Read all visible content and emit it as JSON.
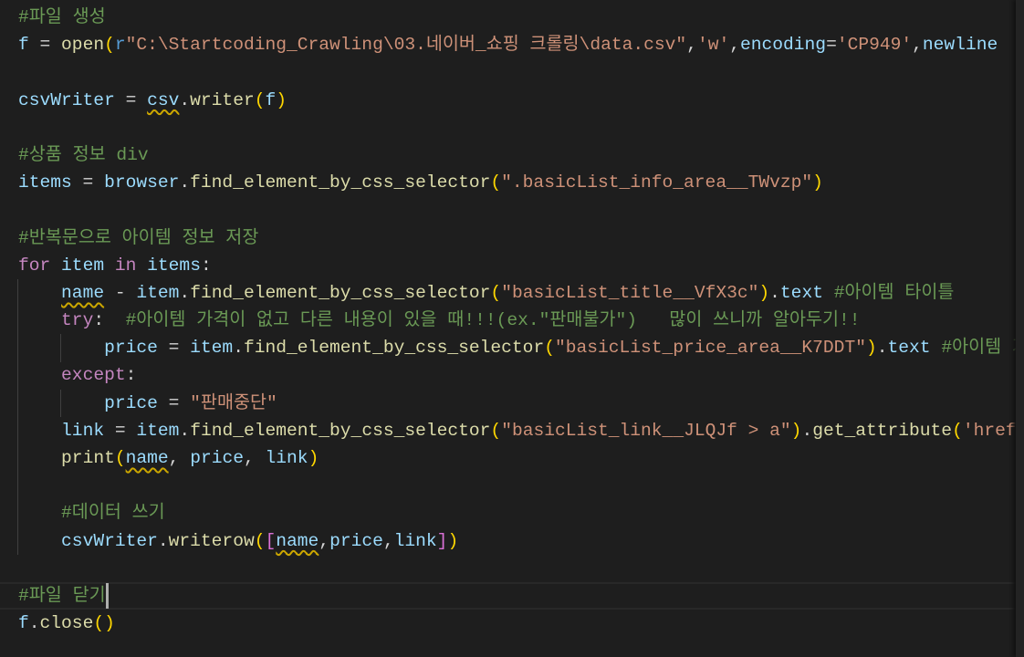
{
  "editor": {
    "current_line": 22,
    "lines": [
      [
        [
          "cm",
          "#파일 생성"
        ]
      ],
      [
        [
          "var",
          "f"
        ],
        [
          "def",
          " = "
        ],
        [
          "fn",
          "open"
        ],
        [
          "b1",
          "("
        ],
        [
          "pre",
          "r"
        ],
        [
          "str",
          "\"C:\\Startcoding_Crawling\\03.네이버_쇼핑 크롤링\\data.csv\""
        ],
        [
          "def",
          ","
        ],
        [
          "str",
          "'w'"
        ],
        [
          "def",
          ","
        ],
        [
          "var",
          "encoding"
        ],
        [
          "def",
          "="
        ],
        [
          "str",
          "'CP949'"
        ],
        [
          "def",
          ","
        ],
        [
          "var",
          "newline"
        ]
      ],
      [],
      [
        [
          "var",
          "csvWriter"
        ],
        [
          "def",
          " = "
        ],
        [
          "var",
          "csv",
          1
        ],
        [
          "def",
          "."
        ],
        [
          "fn",
          "writer"
        ],
        [
          "b1",
          "("
        ],
        [
          "var",
          "f"
        ],
        [
          "b1",
          ")"
        ]
      ],
      [],
      [
        [
          "cm",
          "#상품 정보 div"
        ]
      ],
      [
        [
          "var",
          "items"
        ],
        [
          "def",
          " = "
        ],
        [
          "var",
          "browser"
        ],
        [
          "def",
          "."
        ],
        [
          "fn",
          "find_element_by_css_selector"
        ],
        [
          "b1",
          "("
        ],
        [
          "str",
          "\".basicList_info_area__TWvzp\""
        ],
        [
          "b1",
          ")"
        ]
      ],
      [],
      [
        [
          "cm",
          "#반복문으로 아이템 정보 저장"
        ]
      ],
      [
        [
          "kw",
          "for"
        ],
        [
          "def",
          " "
        ],
        [
          "var",
          "item"
        ],
        [
          "def",
          " "
        ],
        [
          "kw",
          "in"
        ],
        [
          "def",
          " "
        ],
        [
          "var",
          "items"
        ],
        [
          "def",
          ":"
        ]
      ],
      [
        [
          "def",
          "    "
        ],
        [
          "var",
          "name",
          1
        ],
        [
          "def",
          " - "
        ],
        [
          "var",
          "item"
        ],
        [
          "def",
          "."
        ],
        [
          "fn",
          "find_element_by_css_selector"
        ],
        [
          "b1",
          "("
        ],
        [
          "str",
          "\"basicList_title__VfX3c\""
        ],
        [
          "b1",
          ")"
        ],
        [
          "def",
          "."
        ],
        [
          "var",
          "text"
        ],
        [
          "def",
          " "
        ],
        [
          "cm",
          "#아이템 타이틀"
        ]
      ],
      [
        [
          "def",
          "    "
        ],
        [
          "kw",
          "try"
        ],
        [
          "def",
          ":  "
        ],
        [
          "cm",
          "#아이템 가격이 없고 다른 내용이 있을 때!!!(ex.\"판매불가\")   많이 쓰니까 알아두기!!"
        ]
      ],
      [
        [
          "def",
          "        "
        ],
        [
          "var",
          "price"
        ],
        [
          "def",
          " = "
        ],
        [
          "var",
          "item"
        ],
        [
          "def",
          "."
        ],
        [
          "fn",
          "find_element_by_css_selector"
        ],
        [
          "b1",
          "("
        ],
        [
          "str",
          "\"basicList_price_area__K7DDT\""
        ],
        [
          "b1",
          ")"
        ],
        [
          "def",
          "."
        ],
        [
          "var",
          "text"
        ],
        [
          "def",
          " "
        ],
        [
          "cm",
          "#아이템 가격"
        ]
      ],
      [
        [
          "def",
          "    "
        ],
        [
          "kw",
          "except"
        ],
        [
          "def",
          ":"
        ]
      ],
      [
        [
          "def",
          "        "
        ],
        [
          "var",
          "price"
        ],
        [
          "def",
          " = "
        ],
        [
          "str",
          "\"판매중단\""
        ]
      ],
      [
        [
          "def",
          "    "
        ],
        [
          "var",
          "link"
        ],
        [
          "def",
          " = "
        ],
        [
          "var",
          "item"
        ],
        [
          "def",
          "."
        ],
        [
          "fn",
          "find_element_by_css_selector"
        ],
        [
          "b1",
          "("
        ],
        [
          "str",
          "\"basicList_link__JLQJf > a\""
        ],
        [
          "b1",
          ")"
        ],
        [
          "def",
          "."
        ],
        [
          "fn",
          "get_attribute"
        ],
        [
          "b1",
          "("
        ],
        [
          "str",
          "'href'"
        ]
      ],
      [
        [
          "def",
          "    "
        ],
        [
          "fn",
          "print"
        ],
        [
          "b1",
          "("
        ],
        [
          "var",
          "name",
          1
        ],
        [
          "def",
          ", "
        ],
        [
          "var",
          "price"
        ],
        [
          "def",
          ", "
        ],
        [
          "var",
          "link"
        ],
        [
          "b1",
          ")"
        ]
      ],
      [],
      [
        [
          "def",
          "    "
        ],
        [
          "cm",
          "#데이터 쓰기"
        ]
      ],
      [
        [
          "def",
          "    "
        ],
        [
          "var",
          "csvWriter"
        ],
        [
          "def",
          "."
        ],
        [
          "fn",
          "writerow"
        ],
        [
          "b1",
          "("
        ],
        [
          "b2",
          "["
        ],
        [
          "var",
          "name",
          1
        ],
        [
          "def",
          ","
        ],
        [
          "var",
          "price"
        ],
        [
          "def",
          ","
        ],
        [
          "var",
          "link"
        ],
        [
          "b2",
          "]"
        ],
        [
          "b1",
          ")"
        ]
      ],
      [],
      [
        [
          "cm",
          "#파일 닫기"
        ]
      ],
      [
        [
          "var",
          "f"
        ],
        [
          "def",
          "."
        ],
        [
          "fn",
          "close"
        ],
        [
          "b1",
          "()"
        ]
      ]
    ]
  },
  "colors": {
    "background": "#1e1e1e",
    "comment": "#6a9955",
    "string": "#ce9178",
    "keyword": "#c586c0",
    "variable": "#9cdcfe",
    "function": "#dcdcaa",
    "bracket": "#ffd700"
  }
}
